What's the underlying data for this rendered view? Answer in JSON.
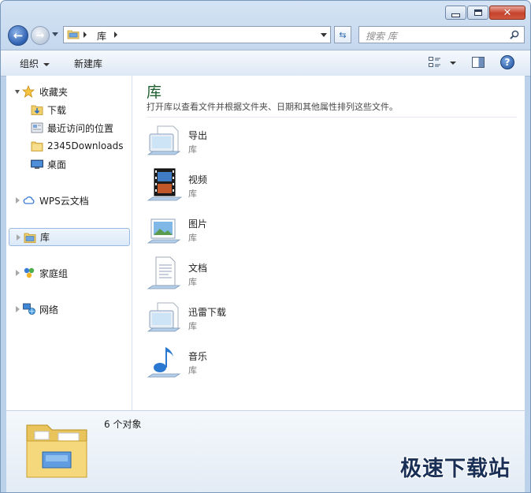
{
  "window": {
    "caption_buttons": [
      "minimize",
      "maximize",
      "close"
    ]
  },
  "nav": {
    "address_path": "库",
    "search_placeholder": "搜索 库"
  },
  "toolbar": {
    "organize_label": "组织",
    "new_library_label": "新建库"
  },
  "sidebar": {
    "favorites": {
      "label": "收藏夹",
      "items": [
        {
          "label": "下载",
          "icon": "download-folder-icon"
        },
        {
          "label": "最近访问的位置",
          "icon": "recent-places-icon"
        },
        {
          "label": "2345Downloads",
          "icon": "folder-icon"
        },
        {
          "label": "桌面",
          "icon": "desktop-icon"
        }
      ]
    },
    "wps_cloud": "WPS云文档",
    "libraries": "库",
    "homegroup": "家庭组",
    "network": "网络"
  },
  "main": {
    "title": "库",
    "description": "打开库以查看文件并根据文件夹、日期和其他属性排列这些文件。",
    "libraries": [
      {
        "name": "导出",
        "type": "库",
        "icon": "generic-library-icon"
      },
      {
        "name": "视频",
        "type": "库",
        "icon": "video-library-icon"
      },
      {
        "name": "图片",
        "type": "库",
        "icon": "pictures-library-icon"
      },
      {
        "name": "文档",
        "type": "库",
        "icon": "documents-library-icon"
      },
      {
        "name": "迅雷下载",
        "type": "库",
        "icon": "generic-library-icon"
      },
      {
        "name": "音乐",
        "type": "库",
        "icon": "music-library-icon"
      }
    ]
  },
  "details": {
    "count": "6 个对象"
  },
  "watermark": "极速下载站",
  "colors": {
    "title_green": "#1e5d2e",
    "frame_blue": "#c5d8ee",
    "selection": "#dbe9f8"
  }
}
